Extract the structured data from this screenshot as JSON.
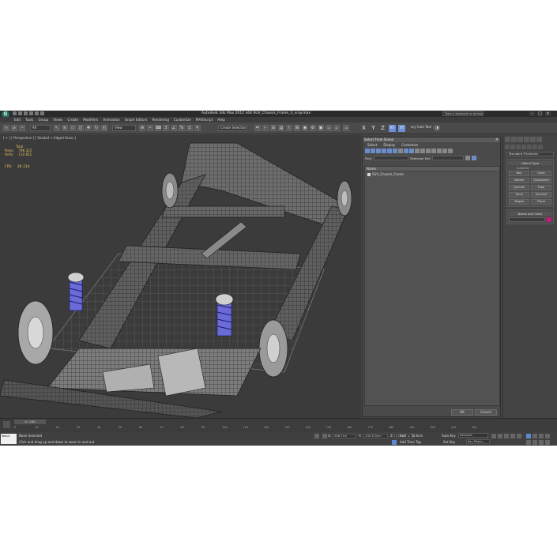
{
  "window": {
    "title": "Autodesk 3ds Max  2012 x64     SUV_Chassis_Frame_3_vray.max",
    "search_placeholder": "Type a keyword or phrase"
  },
  "menu": [
    "Edit",
    "Tools",
    "Group",
    "Views",
    "Create",
    "Modifiers",
    "Animation",
    "Graph Editors",
    "Rendering",
    "Customize",
    "MAXScript",
    "Help"
  ],
  "toolbar": {
    "selection_filter": "All",
    "ref_coord": "View",
    "named_selection": "Create Selection Se",
    "axes": [
      "X",
      "Y",
      "Z",
      "XY",
      "XY"
    ],
    "active_axis": "XY",
    "tool_label": "ary Cam Tool"
  },
  "viewport": {
    "label": "[ + ] [ Perspective ] [ Shaded + Edged Faces ]",
    "stats": {
      "header": "Total",
      "polys_label": "Polys:",
      "polys_value": "796 325",
      "verts_label": "Verts:",
      "verts_value": "110 852",
      "fps_label": "FPS:",
      "fps_value": "39.314"
    }
  },
  "dialog": {
    "title": "Select From Scene",
    "menu": [
      "Select",
      "Display",
      "Customize"
    ],
    "find_label": "Find:",
    "selection_set_label": "Selection Set:",
    "column_header": "Name",
    "items": [
      "SUV_Chassis_Frame"
    ],
    "ok_label": "OK",
    "cancel_label": "Cancel"
  },
  "command_panel": {
    "category": "Standard Primitives",
    "object_type_header": "Object Type",
    "autogrid": "AutoGrid",
    "primitives": [
      "Box",
      "Cone",
      "Sphere",
      "GeoSphere",
      "Cylinder",
      "Tube",
      "Torus",
      "Pyramid",
      "Teapot",
      "Plane"
    ],
    "name_color_header": "Name and Color",
    "object_color": "#c41a78"
  },
  "timeline": {
    "frame_display": "0 / 100",
    "ticks": [
      "0",
      "10",
      "20",
      "30",
      "40",
      "50",
      "60",
      "70",
      "80",
      "90",
      "100",
      "110",
      "120",
      "130",
      "140",
      "150",
      "160",
      "170",
      "180",
      "190",
      "200",
      "210",
      "220"
    ]
  },
  "status": {
    "maxscript_line1": "Welco",
    "maxscript_line2": "me t",
    "selection_text": "None Selected",
    "prompt_text": "Click and drag up-and-down to zoom in and out",
    "x_label": "X:",
    "y_label": "Y:",
    "z_label": "Z:",
    "x_value": "-906.7cm",
    "y_value": "-132.372cm",
    "z_value": "0.0cm",
    "grid_text": "Grid = 10.0cm",
    "add_time_tag": "Add Time Tag",
    "auto_key": "Auto Key",
    "set_key": "Set Key",
    "key_mode": "Selected",
    "key_filters": "Key Filters..."
  }
}
